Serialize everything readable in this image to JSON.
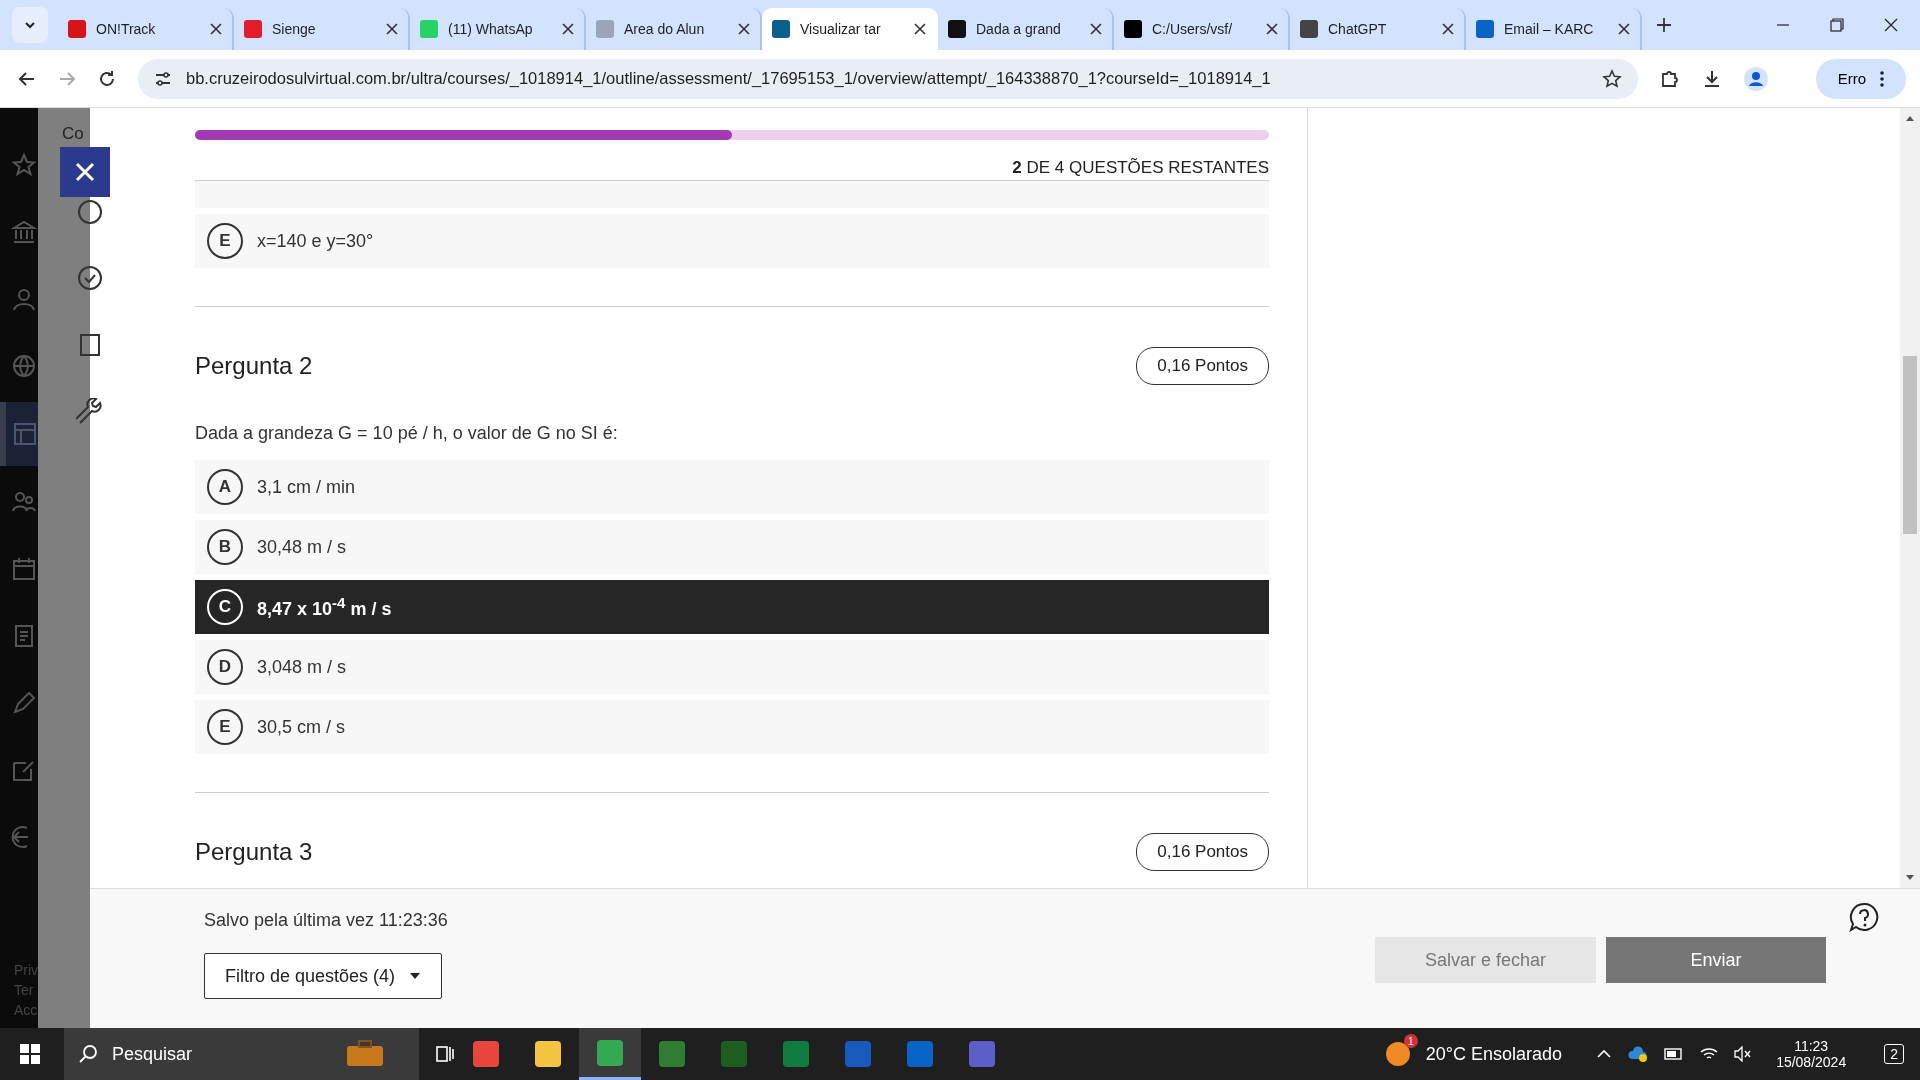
{
  "browser": {
    "tabs": [
      {
        "title": "ON!Track",
        "color": "#d7141a",
        "selected": false
      },
      {
        "title": "Sienge",
        "color": "#e21c2a",
        "selected": false
      },
      {
        "title": "(11) WhatsAp",
        "color": "#25d366",
        "selected": false
      },
      {
        "title": "Area do Alun",
        "color": "#9aa5b8",
        "selected": false
      },
      {
        "title": "Visualizar tar",
        "color": "#0b5f8f",
        "selected": true
      },
      {
        "title": "Dada a grand",
        "color": "#111111",
        "selected": false
      },
      {
        "title": "C:/Users/vsf/",
        "color": "#000000",
        "selected": false
      },
      {
        "title": "ChatGPT",
        "color": "#444444",
        "selected": false
      },
      {
        "title": "Email – KARC",
        "color": "#0a64c8",
        "selected": false
      }
    ],
    "url": "bb.cruzeirodosulvirtual.com.br/ultra/courses/_1018914_1/outline/assessment/_17695153_1/overview/attempt/_164338870_1?courseId=_1018914_1",
    "profile_button": "Erro"
  },
  "sidebar": {
    "heading": "Co",
    "footer": [
      "Priv",
      "Ter",
      "Acc"
    ]
  },
  "progress": {
    "level": 0.5,
    "remaining": "**2** DE 4 QUESTÕES RESTANTES"
  },
  "previous_question": {
    "options": [
      {
        "letter": "E",
        "text": "x=140 e y=30°",
        "selected": false
      }
    ]
  },
  "questions": [
    {
      "title": "Pergunta 2",
      "points": "0,16 Pontos",
      "prompt": "Dada a grandeza G = 10 pé / h, o valor de G no SI é:",
      "options": [
        {
          "letter": "A",
          "text": "3,1 cm / min",
          "selected": false
        },
        {
          "letter": "B",
          "text": "30,48 m / s",
          "selected": false
        },
        {
          "letter": "C",
          "text": "8,47 x 10$^{-4}$ m / s",
          "selected": true
        },
        {
          "letter": "D",
          "text": "3,048 m / s",
          "selected": false
        },
        {
          "letter": "E",
          "text": "30,5 cm / s",
          "selected": false
        }
      ]
    },
    {
      "title": "Pergunta 3",
      "points": "0,16 Pontos"
    }
  ],
  "footer": {
    "saved": "Salvo pela última vez 11:23:36",
    "filter": "Filtro de questões (4)",
    "save_close": "Salvar e fechar",
    "submit": "Enviar"
  },
  "taskbar": {
    "search": "Pesquisar",
    "weather_badge": "1",
    "weather": "20°C Ensolarado",
    "time": "11:23",
    "date": "15/08/2024",
    "notifications": "2"
  }
}
